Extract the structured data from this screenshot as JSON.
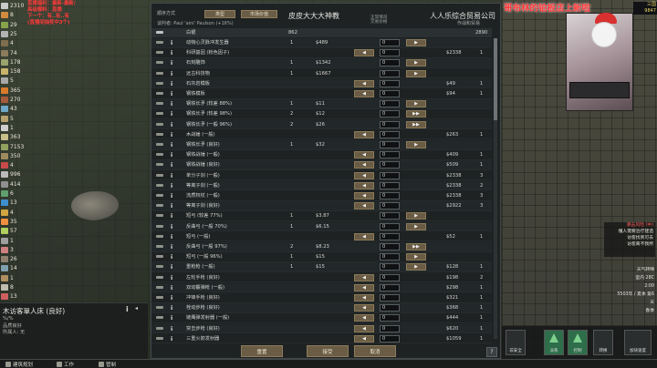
{
  "resources": [
    {
      "value": "2310",
      "color": "#c9c9c9"
    },
    {
      "value": "8",
      "color": "#d28a3c"
    },
    {
      "value": "29",
      "color": "#88a34a"
    },
    {
      "value": "25",
      "color": "#b3b3b3"
    },
    {
      "value": "4",
      "color": "#7e6e4e"
    },
    {
      "value": "74",
      "color": "#8c7c5c"
    },
    {
      "value": "178",
      "color": "#9aa46c"
    },
    {
      "value": "158",
      "color": "#c7b36b"
    },
    {
      "value": "5",
      "color": "#a8a8a8"
    },
    {
      "value": "365",
      "color": "#d97b2c"
    },
    {
      "value": "270",
      "color": "#a55a3a"
    },
    {
      "value": "43",
      "color": "#6da8c8"
    },
    {
      "value": "5",
      "color": "#b6a06b"
    },
    {
      "value": "1",
      "color": "#cfcfcf"
    },
    {
      "value": "363",
      "color": "#c8c08a"
    },
    {
      "value": "7153",
      "color": "#8fa35f"
    },
    {
      "value": "350",
      "color": "#9f8a5e"
    },
    {
      "value": "4",
      "color": "#c94a4a"
    },
    {
      "value": "996",
      "color": "#bcbcbc"
    },
    {
      "value": "414",
      "color": "#8f8f8f"
    },
    {
      "value": "6",
      "color": "#5f9f6f"
    },
    {
      "value": "13",
      "color": "#3f8fcf"
    },
    {
      "value": "4",
      "color": "#cfa53f"
    },
    {
      "value": "35",
      "color": "#ef8f3f"
    },
    {
      "value": "57",
      "color": "#afcf5f"
    },
    {
      "value": "1",
      "color": "#9f9f9f"
    },
    {
      "value": "3",
      "color": "#cf7f7f"
    },
    {
      "value": "26",
      "color": "#8f7f6f"
    },
    {
      "value": "14",
      "color": "#7f9faf"
    },
    {
      "value": "1",
      "color": "#af8f5f"
    },
    {
      "value": "8",
      "color": "#bfbfaf"
    },
    {
      "value": "13",
      "color": "#cf5f5f"
    }
  ],
  "overlay_lines": [
    "直播福利：最新-最新/",
    "高级爆料：直播",
    "下一个：有..有..有",
    "(直播间抽奖中3个)"
  ],
  "inspect": {
    "title": "木访客單人床 (良好)",
    "lines": [
      "%/%",
      "品质良好",
      "所属人: 无"
    ],
    "info_icon": "i",
    "menu_icon": "◂"
  },
  "bottom_tabs": [
    {
      "label": "建筑规划"
    },
    {
      "label": "工作"
    },
    {
      "label": "管制"
    }
  ],
  "trade": {
    "header_small": "顺序方式",
    "sort_button": "类型",
    "filter_button": "市场价值",
    "desc": "谈判者: Paul 'aini' Paulson (+16%)",
    "colony_name": "皮皮大大大神教",
    "mid_small": [
      "正常情况",
      "交易价格"
    ],
    "trader_name": "人人乐综合贸易公司",
    "trader_sub": "作战和贸易",
    "silver": {
      "label": "白银",
      "colony": "862",
      "trader": "2890"
    },
    "rows": [
      {
        "name": "动物心灵脉冲发生器",
        "qty": "1",
        "price": "$489",
        "lbtn": "",
        "rbtn": "▶",
        "tprice": "",
        "tqty": ""
      },
      {
        "name": "科研基因 (粉色因子)",
        "qty": "",
        "price": "",
        "lbtn": "◀",
        "rbtn": "",
        "tprice": "$2338",
        "tqty": "1"
      },
      {
        "name": "石刻雕饰",
        "qty": "1",
        "price": "$1342",
        "lbtn": "",
        "rbtn": "▶",
        "tprice": "",
        "tqty": ""
      },
      {
        "name": "远古科技物",
        "qty": "1",
        "price": "$1667",
        "lbtn": "",
        "rbtn": "▶",
        "tprice": "",
        "tqty": ""
      },
      {
        "name": "石灰岩模板",
        "qty": "",
        "price": "",
        "lbtn": "◀",
        "rbtn": "",
        "tprice": "$49",
        "tqty": "1"
      },
      {
        "name": "钢铁模板",
        "qty": "",
        "price": "",
        "lbtn": "◀",
        "rbtn": "",
        "tprice": "$94",
        "tqty": "1"
      },
      {
        "name": "钢铁长矛 (较差 88%)",
        "qty": "1",
        "price": "$11",
        "lbtn": "",
        "rbtn": "▶",
        "tprice": "",
        "tqty": ""
      },
      {
        "name": "钢铁长矛 (较差 98%)",
        "qty": "2",
        "price": "$12",
        "lbtn": "",
        "rbtn": "▶▶",
        "tprice": "",
        "tqty": ""
      },
      {
        "name": "钢铁长矛 (一般 96%)",
        "qty": "2",
        "price": "$26",
        "lbtn": "",
        "rbtn": "▶▶",
        "tprice": "",
        "tqty": ""
      },
      {
        "name": "木战锤 (一般)",
        "qty": "",
        "price": "",
        "lbtn": "◀",
        "rbtn": "",
        "tprice": "$263",
        "tqty": "1"
      },
      {
        "name": "钢铁长矛 (良好)",
        "qty": "1",
        "price": "$32",
        "lbtn": "",
        "rbtn": "▶",
        "tprice": "",
        "tqty": ""
      },
      {
        "name": "钢铁战锤 (一般)",
        "qty": "",
        "price": "",
        "lbtn": "◀",
        "rbtn": "",
        "tprice": "$409",
        "tqty": "1"
      },
      {
        "name": "钢铁战锤 (良好)",
        "qty": "",
        "price": "",
        "lbtn": "◀",
        "rbtn": "",
        "tprice": "$509",
        "tqty": "1"
      },
      {
        "name": "单分子剑 (一般)",
        "qty": "",
        "price": "",
        "lbtn": "◀",
        "rbtn": "",
        "tprice": "$2338",
        "tqty": "3"
      },
      {
        "name": "等离子剑 (一般)",
        "qty": "",
        "price": "",
        "lbtn": "◀",
        "rbtn": "",
        "tprice": "$2338",
        "tqty": "2"
      },
      {
        "name": "流质权杖 (一般)",
        "qty": "",
        "price": "",
        "lbtn": "◀",
        "rbtn": "",
        "tprice": "$2338",
        "tqty": "3"
      },
      {
        "name": "等离子剑 (良好)",
        "qty": "",
        "price": "",
        "lbtn": "◀",
        "rbtn": "",
        "tprice": "$2922",
        "tqty": "3"
      },
      {
        "name": "短弓 (较差 77%)",
        "qty": "1",
        "price": "$3.87",
        "lbtn": "",
        "rbtn": "▶",
        "tprice": "",
        "tqty": ""
      },
      {
        "name": "反曲弓 (一般 70%)",
        "qty": "1",
        "price": "$6.15",
        "lbtn": "",
        "rbtn": "▶",
        "tprice": "",
        "tqty": ""
      },
      {
        "name": "短弓 (一般)",
        "qty": "",
        "price": "",
        "lbtn": "◀",
        "rbtn": "",
        "tprice": "$52",
        "tqty": "1"
      },
      {
        "name": "反曲弓 (一般 97%)",
        "qty": "2",
        "price": "$8.23",
        "lbtn": "",
        "rbtn": "▶▶",
        "tprice": "",
        "tqty": ""
      },
      {
        "name": "短弓 (一般 96%)",
        "qty": "1",
        "price": "$15",
        "lbtn": "",
        "rbtn": "▶",
        "tprice": "",
        "tqty": ""
      },
      {
        "name": "重枪枪 (一般)",
        "qty": "1",
        "price": "$15",
        "lbtn": "",
        "rbtn": "▶",
        "tprice": "$128",
        "tqty": "1"
      },
      {
        "name": "左轮手枪 (良好)",
        "qty": "",
        "price": "",
        "lbtn": "◀",
        "rbtn": "",
        "tprice": "$198",
        "tqty": "2"
      },
      {
        "name": "双动霰弹枪 (一般)",
        "qty": "",
        "price": "",
        "lbtn": "◀",
        "rbtn": "",
        "tprice": "$298",
        "tqty": "1"
      },
      {
        "name": "冲锋手枪 (良好)",
        "qty": "",
        "price": "",
        "lbtn": "◀",
        "rbtn": "",
        "tprice": "$321",
        "tqty": "1"
      },
      {
        "name": "栓动步枪 (良好)",
        "qty": "",
        "price": "",
        "lbtn": "◀",
        "rbtn": "",
        "tprice": "$368",
        "tqty": "1"
      },
      {
        "name": "链鹰弹发射器 (一般)",
        "qty": "",
        "price": "",
        "lbtn": "◀",
        "rbtn": "",
        "tprice": "$444",
        "tqty": "1"
      },
      {
        "name": "突击步枪 (良好)",
        "qty": "",
        "price": "",
        "lbtn": "◀",
        "rbtn": "",
        "tprice": "$620",
        "tqty": "1"
      },
      {
        "name": "三重火箭发射器",
        "qty": "",
        "price": "",
        "lbtn": "◀",
        "rbtn": "",
        "tprice": "$1059",
        "tqty": "1"
      }
    ],
    "reset_label": "重置",
    "accept_label": "接受",
    "cancel_label": "取消",
    "help_label": "?"
  },
  "stream": {
    "title": "哥布林的铂板店上新啦",
    "clock": [
      "三国",
      "9847"
    ]
  },
  "alerts": [
    "袭击风险 (中)",
    "懂人需要治疗建造",
    "访客找到可去",
    "访客离不我所"
  ],
  "info_lines": [
    "天气转晴",
    "室内 28C",
    "2:00",
    "5503年 / 夏季 第6天",
    "春季"
  ],
  "right_bottom": [
    {
      "label": "非安全"
    },
    {
      "label": "派系"
    },
    {
      "label": "控制"
    },
    {
      "label": "转换"
    },
    {
      "label": "加快速度"
    }
  ]
}
